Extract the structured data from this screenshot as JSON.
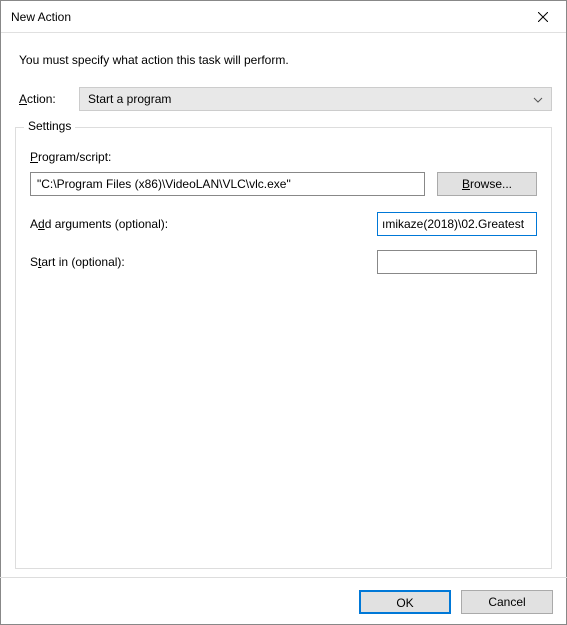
{
  "window": {
    "title": "New Action"
  },
  "instruction": "You must specify what action this task will perform.",
  "action": {
    "label": "Action:",
    "selected": "Start a program"
  },
  "settings": {
    "legend": "Settings",
    "program_label": "Program/script:",
    "program_value": "\"C:\\Program Files (x86)\\VideoLAN\\VLC\\vlc.exe\"",
    "browse_label": "Browse...",
    "arguments_label_pre": "A",
    "arguments_label_ul": "d",
    "arguments_label_post": "d arguments (optional):",
    "arguments_value": "ımikaze(2018)\\02.Greatest",
    "startin_label_pre": "S",
    "startin_label_ul": "t",
    "startin_label_post": "art in (optional):",
    "startin_value": ""
  },
  "buttons": {
    "ok": "OK",
    "cancel": "Cancel"
  }
}
